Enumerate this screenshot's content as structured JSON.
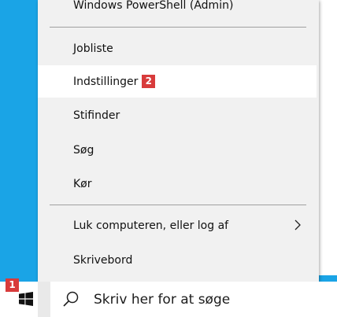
{
  "start_menu": {
    "items": {
      "powershell": {
        "label": "Windows PowerShell (Admin)"
      },
      "task_manager": {
        "label": "Jobliste"
      },
      "settings": {
        "label": "Indstillinger",
        "badge": "2"
      },
      "explorer": {
        "label": "Stifinder"
      },
      "search": {
        "label": "Søg"
      },
      "run": {
        "label": "Kør"
      },
      "shutdown": {
        "label": "Luk computeren, eller log af",
        "submenu_icon": "chevron-right-icon"
      },
      "desktop": {
        "label": "Skrivebord"
      }
    },
    "highlighted_item": "Indstillinger"
  },
  "taskbar": {
    "start_badge": "1",
    "search_placeholder": "Skriv her for at søge",
    "icons": [
      "windows-logo-icon",
      "search-icon"
    ]
  },
  "colors": {
    "desktop_background": "#1aa4e6",
    "menu_background": "#f1f1f1",
    "highlight": "#ffffff",
    "badge": "#d83b3b"
  }
}
